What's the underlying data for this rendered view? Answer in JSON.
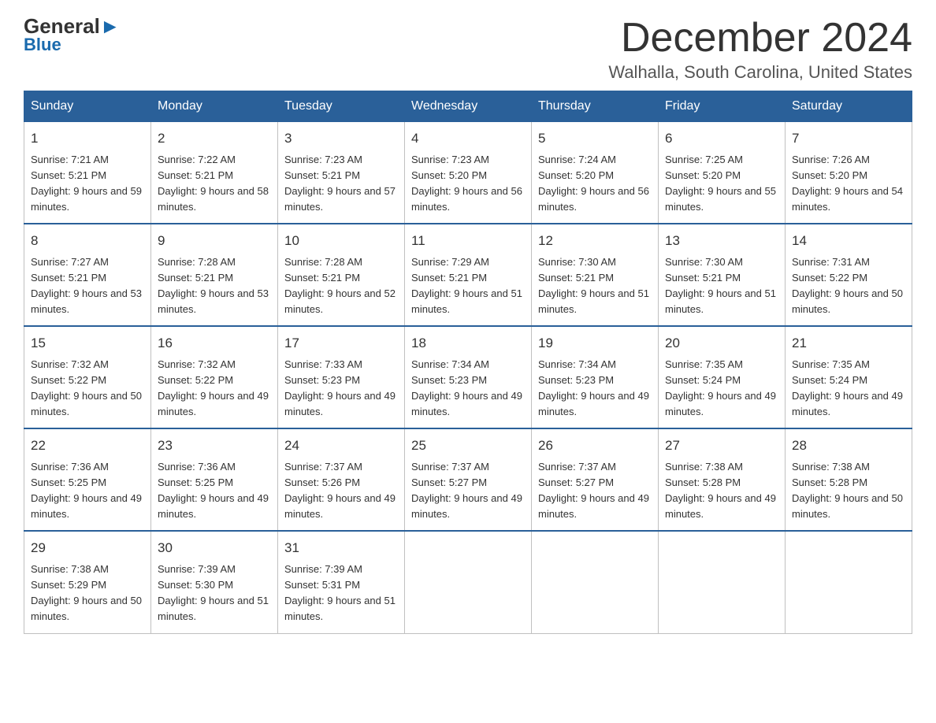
{
  "header": {
    "logo_general": "General",
    "logo_blue": "Blue",
    "title": "December 2024",
    "subtitle": "Walhalla, South Carolina, United States"
  },
  "weekdays": [
    "Sunday",
    "Monday",
    "Tuesday",
    "Wednesday",
    "Thursday",
    "Friday",
    "Saturday"
  ],
  "weeks": [
    [
      {
        "day": "1",
        "sunrise": "7:21 AM",
        "sunset": "5:21 PM",
        "daylight": "9 hours and 59 minutes."
      },
      {
        "day": "2",
        "sunrise": "7:22 AM",
        "sunset": "5:21 PM",
        "daylight": "9 hours and 58 minutes."
      },
      {
        "day": "3",
        "sunrise": "7:23 AM",
        "sunset": "5:21 PM",
        "daylight": "9 hours and 57 minutes."
      },
      {
        "day": "4",
        "sunrise": "7:23 AM",
        "sunset": "5:20 PM",
        "daylight": "9 hours and 56 minutes."
      },
      {
        "day": "5",
        "sunrise": "7:24 AM",
        "sunset": "5:20 PM",
        "daylight": "9 hours and 56 minutes."
      },
      {
        "day": "6",
        "sunrise": "7:25 AM",
        "sunset": "5:20 PM",
        "daylight": "9 hours and 55 minutes."
      },
      {
        "day": "7",
        "sunrise": "7:26 AM",
        "sunset": "5:20 PM",
        "daylight": "9 hours and 54 minutes."
      }
    ],
    [
      {
        "day": "8",
        "sunrise": "7:27 AM",
        "sunset": "5:21 PM",
        "daylight": "9 hours and 53 minutes."
      },
      {
        "day": "9",
        "sunrise": "7:28 AM",
        "sunset": "5:21 PM",
        "daylight": "9 hours and 53 minutes."
      },
      {
        "day": "10",
        "sunrise": "7:28 AM",
        "sunset": "5:21 PM",
        "daylight": "9 hours and 52 minutes."
      },
      {
        "day": "11",
        "sunrise": "7:29 AM",
        "sunset": "5:21 PM",
        "daylight": "9 hours and 51 minutes."
      },
      {
        "day": "12",
        "sunrise": "7:30 AM",
        "sunset": "5:21 PM",
        "daylight": "9 hours and 51 minutes."
      },
      {
        "day": "13",
        "sunrise": "7:30 AM",
        "sunset": "5:21 PM",
        "daylight": "9 hours and 51 minutes."
      },
      {
        "day": "14",
        "sunrise": "7:31 AM",
        "sunset": "5:22 PM",
        "daylight": "9 hours and 50 minutes."
      }
    ],
    [
      {
        "day": "15",
        "sunrise": "7:32 AM",
        "sunset": "5:22 PM",
        "daylight": "9 hours and 50 minutes."
      },
      {
        "day": "16",
        "sunrise": "7:32 AM",
        "sunset": "5:22 PM",
        "daylight": "9 hours and 49 minutes."
      },
      {
        "day": "17",
        "sunrise": "7:33 AM",
        "sunset": "5:23 PM",
        "daylight": "9 hours and 49 minutes."
      },
      {
        "day": "18",
        "sunrise": "7:34 AM",
        "sunset": "5:23 PM",
        "daylight": "9 hours and 49 minutes."
      },
      {
        "day": "19",
        "sunrise": "7:34 AM",
        "sunset": "5:23 PM",
        "daylight": "9 hours and 49 minutes."
      },
      {
        "day": "20",
        "sunrise": "7:35 AM",
        "sunset": "5:24 PM",
        "daylight": "9 hours and 49 minutes."
      },
      {
        "day": "21",
        "sunrise": "7:35 AM",
        "sunset": "5:24 PM",
        "daylight": "9 hours and 49 minutes."
      }
    ],
    [
      {
        "day": "22",
        "sunrise": "7:36 AM",
        "sunset": "5:25 PM",
        "daylight": "9 hours and 49 minutes."
      },
      {
        "day": "23",
        "sunrise": "7:36 AM",
        "sunset": "5:25 PM",
        "daylight": "9 hours and 49 minutes."
      },
      {
        "day": "24",
        "sunrise": "7:37 AM",
        "sunset": "5:26 PM",
        "daylight": "9 hours and 49 minutes."
      },
      {
        "day": "25",
        "sunrise": "7:37 AM",
        "sunset": "5:27 PM",
        "daylight": "9 hours and 49 minutes."
      },
      {
        "day": "26",
        "sunrise": "7:37 AM",
        "sunset": "5:27 PM",
        "daylight": "9 hours and 49 minutes."
      },
      {
        "day": "27",
        "sunrise": "7:38 AM",
        "sunset": "5:28 PM",
        "daylight": "9 hours and 49 minutes."
      },
      {
        "day": "28",
        "sunrise": "7:38 AM",
        "sunset": "5:28 PM",
        "daylight": "9 hours and 50 minutes."
      }
    ],
    [
      {
        "day": "29",
        "sunrise": "7:38 AM",
        "sunset": "5:29 PM",
        "daylight": "9 hours and 50 minutes."
      },
      {
        "day": "30",
        "sunrise": "7:39 AM",
        "sunset": "5:30 PM",
        "daylight": "9 hours and 51 minutes."
      },
      {
        "day": "31",
        "sunrise": "7:39 AM",
        "sunset": "5:31 PM",
        "daylight": "9 hours and 51 minutes."
      },
      null,
      null,
      null,
      null
    ]
  ]
}
